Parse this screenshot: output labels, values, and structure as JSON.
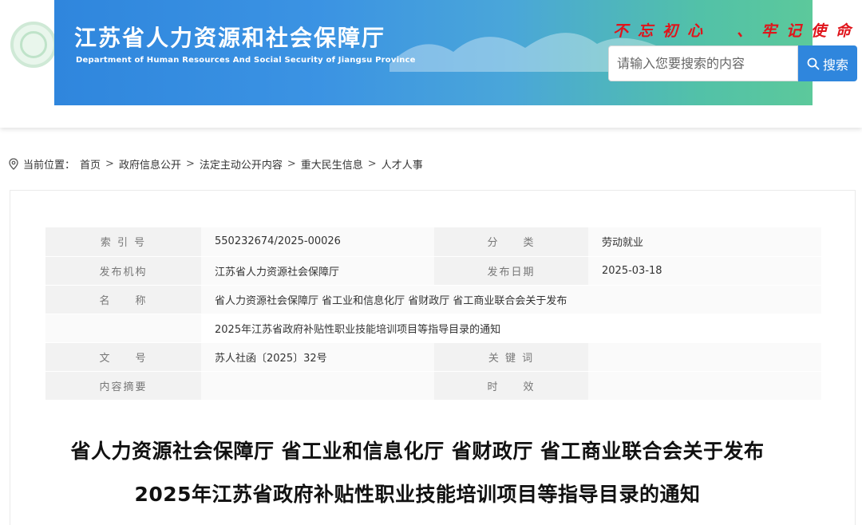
{
  "header": {
    "site_title": "江苏省人力资源和社会保障厅",
    "site_subtitle": "Department of Human Resources And Social Security of Jiangsu Province",
    "slogan": "不忘初心　、牢记使命",
    "search": {
      "placeholder": "请输入您要搜索的内容",
      "button_label": "搜索"
    }
  },
  "breadcrumb": {
    "prefix": "当前位置：",
    "items": [
      "首页",
      "政府信息公开",
      "法定主动公开内容",
      "重大民生信息",
      "人才人事"
    ]
  },
  "info_table": {
    "index_label": "索 引 号",
    "index_value": "550232674/2025-00026",
    "category_label": "分　　类",
    "category_value": "劳动就业",
    "publisher_label": "发布机构",
    "publisher_value": "江苏省人力资源社会保障厅",
    "date_label": "发布日期",
    "date_value": "2025-03-18",
    "name_label": "名　　称",
    "name_line1": "省人力资源社会保障厅 省工业和信息化厅 省财政厅 省工商业联合会关于发布",
    "name_line2": "2025年江苏省政府补贴性职业技能培训项目等指导目录的通知",
    "doc_no_label": "文　　号",
    "doc_no_value": "苏人社函〔2025〕32号",
    "keywords_label": "关 键 词",
    "keywords_value": "",
    "summary_label": "内容摘要",
    "summary_value": "",
    "validity_label": "时　　效",
    "validity_value": ""
  },
  "article": {
    "title_line1": "省人力资源社会保障厅 省工业和信息化厅 省财政厅 省工商业联合会关于发布",
    "title_line2": "2025年江苏省政府补贴性职业技能培训项目等指导目录的通知"
  }
}
